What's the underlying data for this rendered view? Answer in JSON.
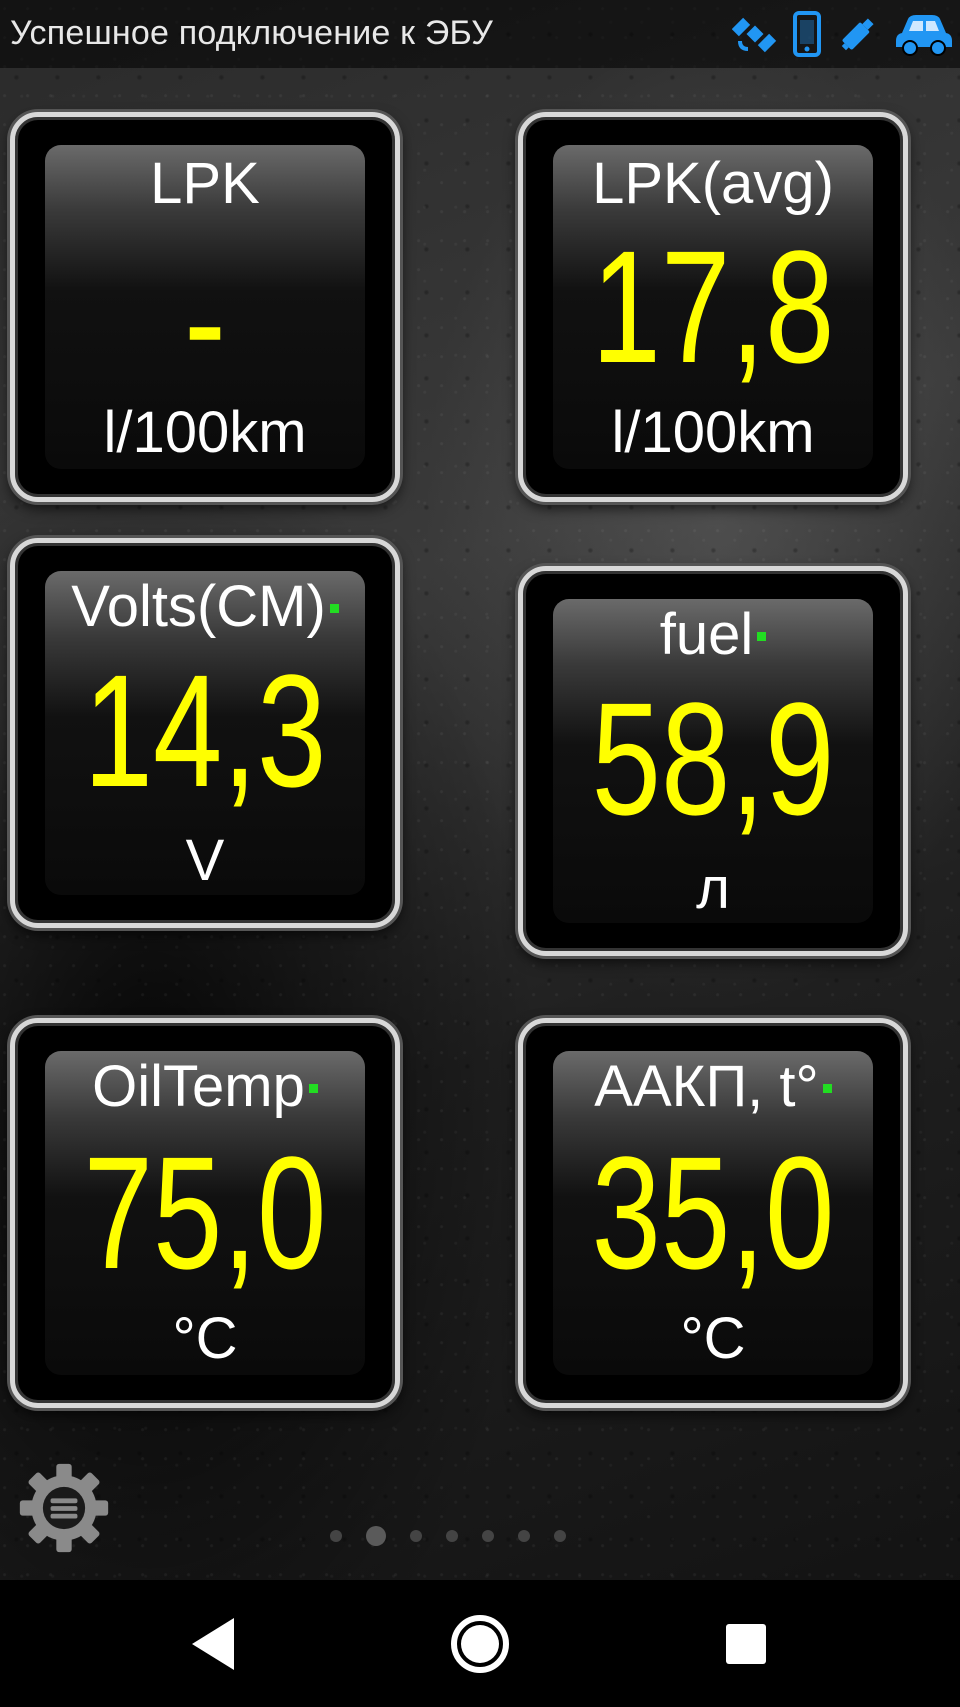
{
  "status_bar": {
    "text": "Успешное подключение к ЭБУ",
    "icons": [
      "gps-satellite-icon",
      "phone-icon",
      "obd-adapter-icon",
      "car-icon"
    ],
    "icon_color": "#2196f3"
  },
  "gauges": [
    {
      "title": "LPK",
      "value": "-",
      "unit": "l/100km",
      "indicator": false
    },
    {
      "title": "LPK(avg)",
      "value": "17,8",
      "unit": "l/100km",
      "indicator": false
    },
    {
      "title": "Volts(CM)",
      "value": "14,3",
      "unit": "V",
      "indicator": true
    },
    {
      "title": "fuel",
      "value": "58,9",
      "unit": "л",
      "indicator": true
    },
    {
      "title": "OilTemp",
      "value": "75,0",
      "unit": "°C",
      "indicator": true
    },
    {
      "title": "ААКП, t°",
      "value": "35,0",
      "unit": "°C",
      "indicator": true
    }
  ],
  "colors": {
    "value": "#ffff00",
    "label": "#ffffff",
    "indicator": "#22dd22"
  },
  "pager": {
    "count": 7,
    "active_index": 1
  },
  "nav_bar": {
    "buttons": [
      "back-icon",
      "home-icon",
      "recents-icon"
    ]
  }
}
